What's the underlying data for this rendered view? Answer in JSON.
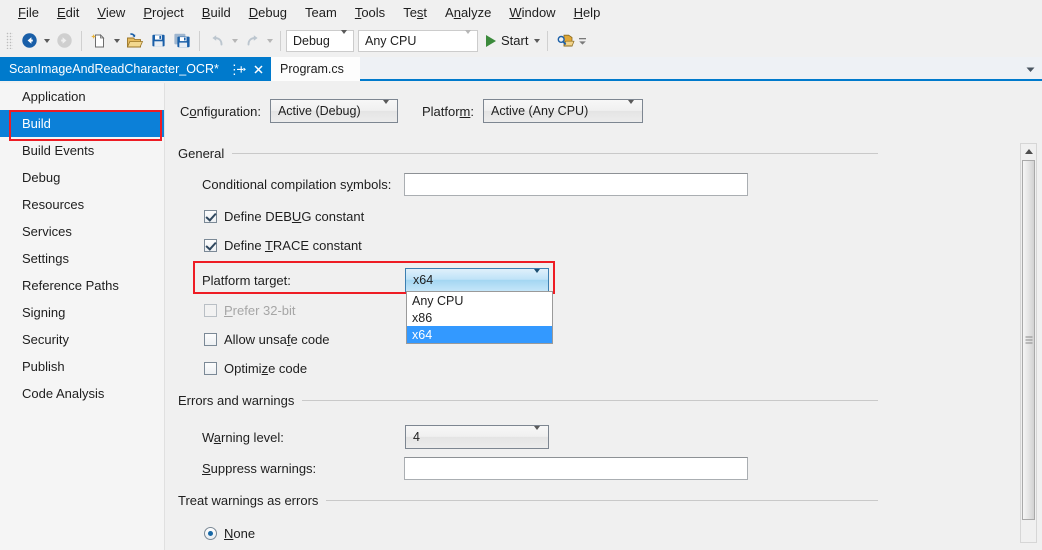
{
  "menubar": {
    "items": [
      {
        "label": "File",
        "accel": "F"
      },
      {
        "label": "Edit",
        "accel": "E"
      },
      {
        "label": "View",
        "accel": "V"
      },
      {
        "label": "Project",
        "accel": "P"
      },
      {
        "label": "Build",
        "accel": "B"
      },
      {
        "label": "Debug",
        "accel": "D"
      },
      {
        "label": "Team",
        "accel": ""
      },
      {
        "label": "Tools",
        "accel": "T"
      },
      {
        "label": "Test",
        "accel": "s"
      },
      {
        "label": "Analyze",
        "accel": "n"
      },
      {
        "label": "Window",
        "accel": "W"
      },
      {
        "label": "Help",
        "accel": "H"
      }
    ]
  },
  "toolbar": {
    "navigate_backward_icon": "back-arrow-icon",
    "navigate_forward_icon": "forward-arrow-icon",
    "new_item_icon": "new-file-icon",
    "open_file_icon": "open-folder-icon",
    "save_icon": "save-icon",
    "save_all_icon": "save-all-icon",
    "undo_icon": "undo-icon",
    "redo_icon": "redo-icon",
    "solution_config": "Debug",
    "solution_platform": "Any CPU",
    "start_label": "Start",
    "start_icon": "play-icon",
    "find_icon": "find-in-files-icon",
    "overflow_icon": "toolbar-overflow-icon"
  },
  "tabs": {
    "active": {
      "label": "ScanImageAndReadCharacter_OCR*",
      "pin_icon": "pin-icon",
      "close_icon": "close-icon"
    },
    "inactive": {
      "label": "Program.cs"
    },
    "menu_icon": "tab-list-chevron-icon"
  },
  "sidebar": {
    "items": [
      {
        "label": "Application",
        "selected": false
      },
      {
        "label": "Build",
        "selected": true
      },
      {
        "label": "Build Events",
        "selected": false
      },
      {
        "label": "Debug",
        "selected": false
      },
      {
        "label": "Resources",
        "selected": false
      },
      {
        "label": "Services",
        "selected": false
      },
      {
        "label": "Settings",
        "selected": false
      },
      {
        "label": "Reference Paths",
        "selected": false
      },
      {
        "label": "Signing",
        "selected": false
      },
      {
        "label": "Security",
        "selected": false
      },
      {
        "label": "Publish",
        "selected": false
      },
      {
        "label": "Code Analysis",
        "selected": false
      }
    ]
  },
  "main": {
    "configuration": {
      "label_pre": "C",
      "label_accel": "o",
      "label_post": "nfiguration:",
      "value": "Active (Debug)"
    },
    "platform": {
      "label_pre": "Platfor",
      "label_accel": "m",
      "label_post": ":",
      "value": "Active (Any CPU)"
    },
    "general_section": "General",
    "conditional_symbols": {
      "label_pre": "Conditional compilation s",
      "label_accel": "y",
      "label_post": "mbols:",
      "value": ""
    },
    "define_debug": {
      "label_pre": "Define DEB",
      "label_accel": "U",
      "label_post": "G constant",
      "checked": true
    },
    "define_trace": {
      "label_pre": "Define ",
      "label_accel": "T",
      "label_post": "RACE constant",
      "checked": true
    },
    "platform_target": {
      "label_pre": "Platform tar",
      "label_accel": "g",
      "label_post": "et:",
      "value": "x64",
      "options": [
        "Any CPU",
        "x86",
        "x64"
      ],
      "selected_option": "x64",
      "open": true
    },
    "prefer_32bit": {
      "label_pre": "",
      "label_accel": "P",
      "label_post": "refer 32-bit",
      "checked": false,
      "disabled": true
    },
    "allow_unsafe": {
      "label_pre": "Allow unsa",
      "label_accel": "f",
      "label_post": "e code",
      "checked": false
    },
    "optimize_code": {
      "label_pre": "Optimi",
      "label_accel": "z",
      "label_post": "e code",
      "checked": false
    },
    "errors_section": "Errors and warnings",
    "warning_level": {
      "label_pre": "W",
      "label_accel": "a",
      "label_post": "rning level:",
      "value": "4"
    },
    "suppress_warnings": {
      "label_pre": "",
      "label_accel": "S",
      "label_post": "uppress warnings:",
      "value": ""
    },
    "treat_section": "Treat warnings as errors",
    "treat_none": {
      "label_pre": "",
      "label_accel": "N",
      "label_post": "one",
      "checked": true
    }
  },
  "colors": {
    "accent": "#007acc",
    "selection": "#0c80d8",
    "highlight_box": "#ee1c24",
    "dropdown_selected": "#3399ff",
    "play_green": "#3b8a3b"
  }
}
